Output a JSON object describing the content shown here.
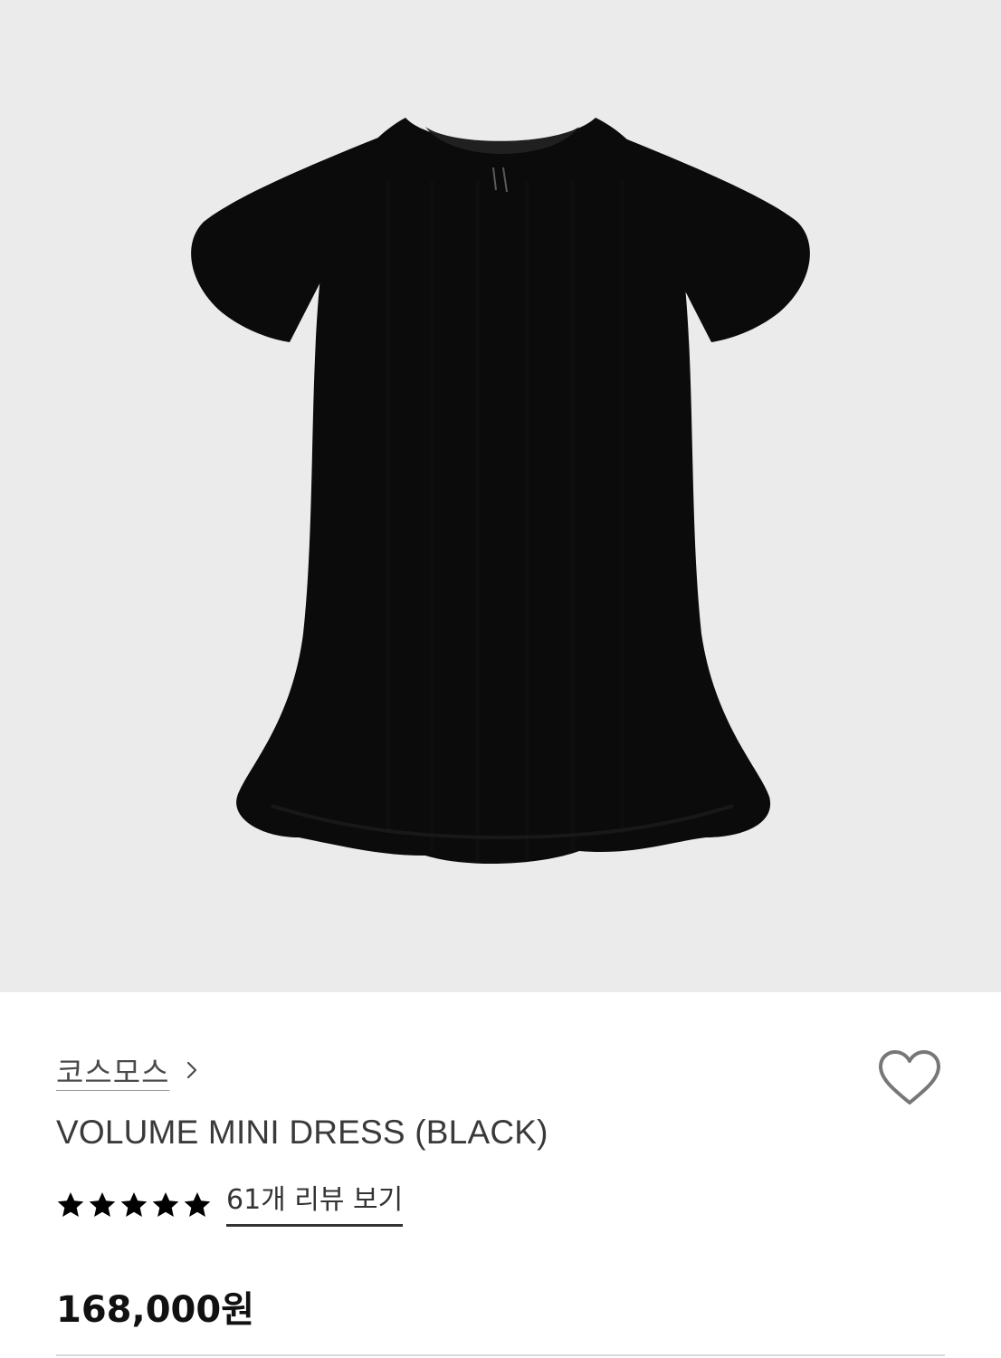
{
  "product_image": {
    "alt": "VOLUME MINI DRESS (BLACK)",
    "background_color": "#ebebeb",
    "garment_color": "#0b0b0b"
  },
  "product": {
    "brand": "코스모스",
    "name": "VOLUME MINI DRESS (BLACK)",
    "rating_stars": 5,
    "review_link_label": "61개 리뷰 보기",
    "price": "168,000원"
  },
  "icons": {
    "brand_chevron": "chevron-right-icon",
    "wishlist": "heart-outline-icon",
    "star": "star-filled-icon"
  },
  "colors": {
    "text_primary": "#111111",
    "text_secondary": "#4a4a4a",
    "heart_outline": "#777777"
  }
}
